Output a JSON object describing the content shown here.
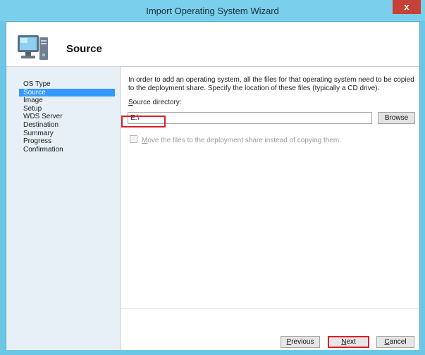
{
  "window": {
    "title": "Import Operating System Wizard",
    "close_label": "x"
  },
  "header": {
    "title": "Source",
    "icon": "computer-icon"
  },
  "nav": {
    "items": [
      {
        "label": "OS Type",
        "active": false
      },
      {
        "label": "Source",
        "active": true
      },
      {
        "label": "Image",
        "active": false
      },
      {
        "label": "Setup",
        "active": false
      },
      {
        "label": "WDS Server",
        "active": false
      },
      {
        "label": "Destination",
        "active": false
      },
      {
        "label": "Summary",
        "active": false
      },
      {
        "label": "Progress",
        "active": false
      },
      {
        "label": "Confirmation",
        "active": false
      }
    ]
  },
  "main": {
    "instructions": "In order to add an operating system, all the files for that operating system need to be copied to the deployment share.  Specify the location of these files (typically a CD drive).",
    "source_label_prefix": "S",
    "source_label_rest": "ource directory:",
    "source_value": "E:\\",
    "browse_label": "Browse",
    "move_files_checked": false,
    "move_files_prefix": "M",
    "move_files_rest": "ove the files to the deployment share instead of copying them."
  },
  "footer": {
    "previous_prefix": "P",
    "previous_rest": "revious",
    "next_prefix": "N",
    "next_rest": "ext",
    "cancel_prefix": "C",
    "cancel_rest": "ancel"
  },
  "colors": {
    "titlebar": "#7acfec",
    "selected": "#3399ff",
    "highlight": "#d8202c",
    "sidebar": "#e7f0f6"
  }
}
